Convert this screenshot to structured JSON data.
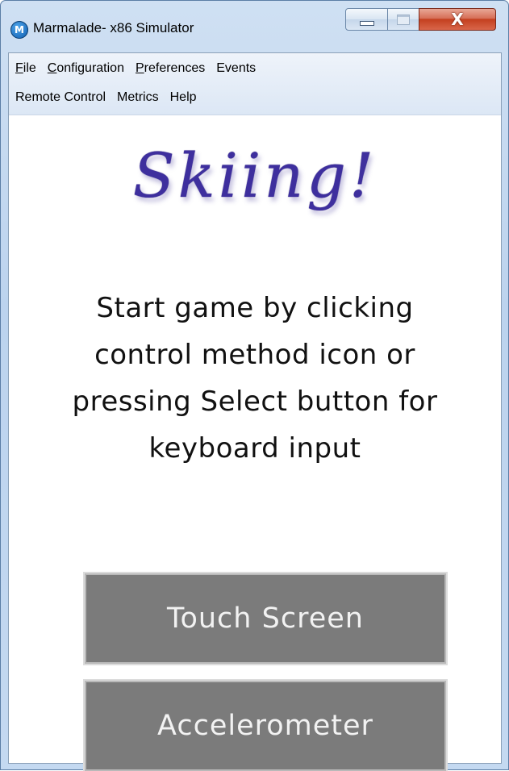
{
  "window": {
    "title": "Marmalade- x86 Simulator",
    "icon_letter": "M",
    "controls": {
      "minimize": "minimize-icon",
      "maximize": "maximize-icon",
      "close_glyph": "X"
    }
  },
  "menu": {
    "row1": [
      {
        "key": "F",
        "rest": "ile"
      },
      {
        "key": "C",
        "rest": "onfiguration"
      },
      {
        "key": "P",
        "rest": "references"
      },
      {
        "key": "",
        "rest": "Events"
      }
    ],
    "row2": [
      {
        "key": "",
        "rest": "Remote Control"
      },
      {
        "key": "",
        "rest": "Metrics"
      },
      {
        "key": "",
        "rest": "Help"
      }
    ]
  },
  "game": {
    "title": "Skiing!",
    "instructions": [
      "Start game by clicking",
      "control method icon or",
      "pressing Select button for",
      "keyboard input"
    ],
    "buttons": {
      "touch": "Touch Screen",
      "accel": "Accelerometer"
    }
  },
  "colors": {
    "logo": "#3e2f9e",
    "button_bg": "#7b7b7b",
    "button_text": "#f2f2f2"
  }
}
